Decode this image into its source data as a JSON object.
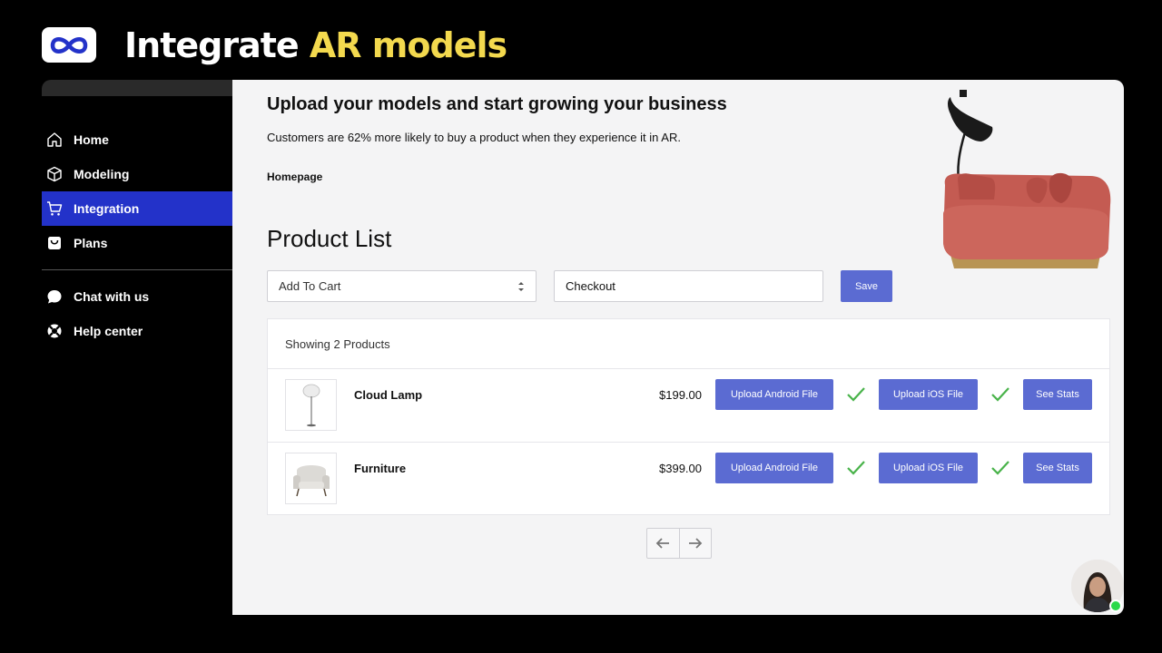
{
  "hero": {
    "title_plain": "Integrate ",
    "title_accent": "AR models",
    "accent_color": "#f3d94e"
  },
  "sidebar": {
    "items": [
      {
        "label": "Home",
        "icon": "home-icon"
      },
      {
        "label": "Modeling",
        "icon": "cube-icon"
      },
      {
        "label": "Integration",
        "icon": "cart-icon",
        "active": true
      },
      {
        "label": "Plans",
        "icon": "box-icon"
      }
    ],
    "secondary": [
      {
        "label": "Chat with us",
        "icon": "chat-icon"
      },
      {
        "label": "Help center",
        "icon": "lifebuoy-icon"
      }
    ],
    "active_color": "#2332c9"
  },
  "main": {
    "heading": "Upload your models and start growing your business",
    "subtext": "Customers are 62% more likely to buy a product when they experience it in AR.",
    "breadcrumb": "Homepage",
    "section_title": "Product List",
    "select_value": "Add To Cart",
    "input_value": "Checkout",
    "save_label": "Save",
    "list_header": "Showing 2 Products",
    "button_color": "#5b6bd2",
    "products": [
      {
        "name": "Cloud Lamp",
        "price": "$199.00",
        "android_label": "Upload Android File",
        "ios_label": "Upload iOS File",
        "stats_label": "See Stats"
      },
      {
        "name": "Furniture",
        "price": "$399.00",
        "android_label": "Upload Android File",
        "ios_label": "Upload iOS File",
        "stats_label": "See Stats"
      }
    ]
  }
}
